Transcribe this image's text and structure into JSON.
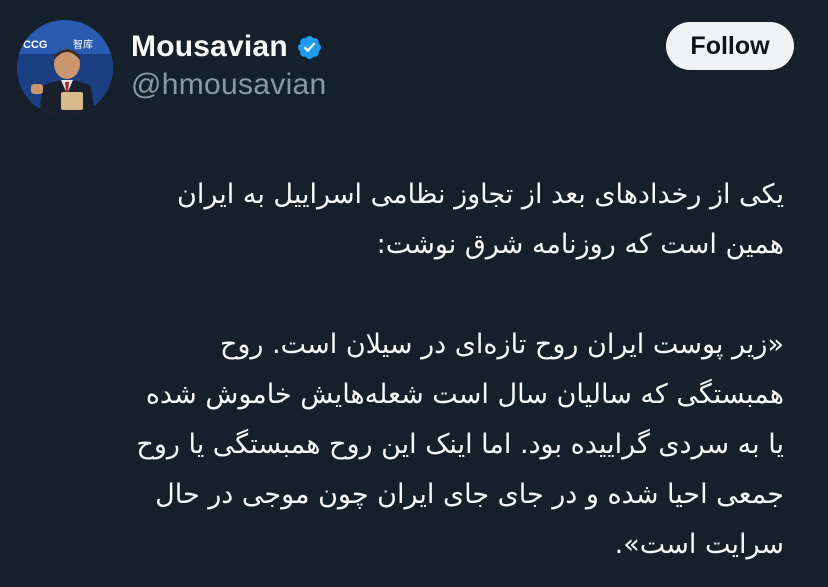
{
  "user": {
    "display_name": "Mousavian",
    "handle": "@hmousavian",
    "verified_icon": "verified-badge-icon",
    "avatar_icon": "profile-photo"
  },
  "actions": {
    "follow_label": "Follow"
  },
  "tweet": {
    "paragraph_1": [
      "یکی از رخدادهای بعد از تجاوز نظامی اسراییل به ایران",
      "همین است که روزنامه شرق نوشت:"
    ],
    "paragraph_2": [
      "«زیر پوست ایران روح تازه‌ای در سیلان است. روح",
      "همبستگی که سالیان سال است شعله‌هایش خاموش شده",
      "یا به سردی گراییده بود. اما اینک این روح همبستگی یا روح",
      "جمعی احیا شده و در جای جای ایران چون موجی در حال",
      "سرایت است»."
    ]
  },
  "colors": {
    "background": "#15202b",
    "text": "#f7f9f9",
    "secondary_text": "#8b98a5",
    "verified": "#1d9bf0",
    "button_bg": "#eff3f4"
  }
}
